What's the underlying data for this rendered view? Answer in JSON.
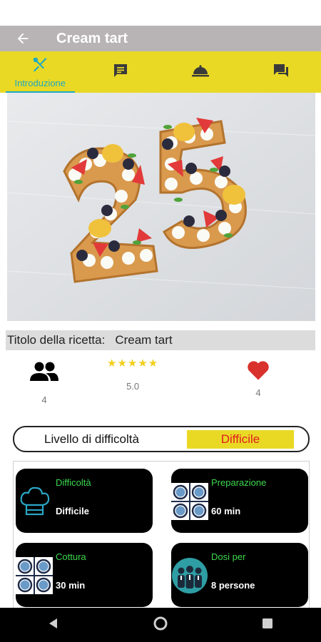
{
  "app_bar": {
    "title": "Cream tart"
  },
  "tabs": [
    {
      "label": "Introduzione",
      "icon": "utensils-icon",
      "active": true
    },
    {
      "label": "",
      "icon": "message-list-icon",
      "active": false
    },
    {
      "label": "",
      "icon": "cloche-icon",
      "active": false
    },
    {
      "label": "",
      "icon": "chat-icon",
      "active": false
    }
  ],
  "recipe": {
    "title_label": "Titolo della ricetta:",
    "title_value": "Cream tart"
  },
  "stats": {
    "servings_count": "4",
    "stars": "★★★★★",
    "rating": "5.0",
    "likes": "4"
  },
  "difficulty": {
    "label": "Livello di difficoltà",
    "value": "Difficile"
  },
  "cards": [
    {
      "title": "Difficoltà",
      "value": "Difficile",
      "icon": "chef-hat-icon"
    },
    {
      "title": "Preparazione",
      "value": "60 min",
      "icon": "tile-pattern-icon"
    },
    {
      "title": "Cottura",
      "value": "30 min",
      "icon": "tile-pattern-icon"
    },
    {
      "title": "Dosi per",
      "value": "8 persone",
      "icon": "people-group-icon"
    }
  ],
  "colors": {
    "accent_yellow": "#e9d925",
    "tab_blue": "#1fa9c0",
    "card_green": "#3cd84d",
    "heart_red": "#d9322c",
    "difficulty_red": "#e21d1d"
  }
}
